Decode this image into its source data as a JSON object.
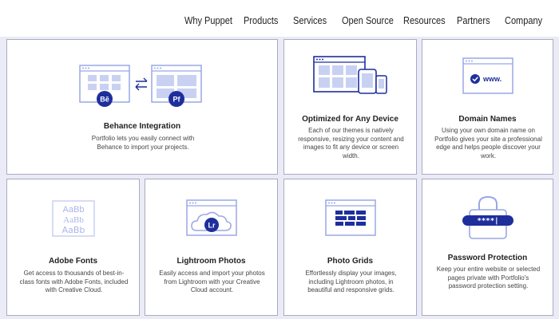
{
  "nav": {
    "items": [
      "Why Puppet",
      "Products",
      "Services",
      "Open Source",
      "Resources",
      "Partners",
      "Company"
    ]
  },
  "colors": {
    "brand_blue": "#1e2f9c",
    "icon_outline": "#9aa7e6",
    "icon_fill": "#c9d1f3",
    "page_bg": "#eaebf6",
    "card_border": "#a9abc2"
  },
  "cards": {
    "behance": {
      "title": "Behance Integration",
      "desc": "Portfolio lets you easily connect with Behance to import your projects.",
      "badge_left": "Bē",
      "badge_right": "Pf",
      "icon": "behance-sync-icon"
    },
    "device": {
      "title": "Optimized for Any Device",
      "desc": "Each of our themes is natively responsive, resizing your content and images to fit any device or screen width.",
      "icon": "devices-icon"
    },
    "domain": {
      "title": "Domain Names",
      "desc": "Using your own domain name on Portfolio gives your site a professional edge and helps people discover your work.",
      "badge": "www.",
      "icon": "domain-icon"
    },
    "fonts": {
      "title": "Adobe Fonts",
      "desc": "Get access to thousands of best-in-class fonts with Adobe Fonts, included with Creative Cloud.",
      "sample": "AaBb",
      "icon": "fonts-icon"
    },
    "lightroom": {
      "title": "Lightroom Photos",
      "desc": "Easily access and import your photos from Lightroom with your Creative Cloud account.",
      "badge": "Lr",
      "icon": "lightroom-cloud-icon"
    },
    "grids": {
      "title": "Photo Grids",
      "desc": "Effortlessly display your images, including Lightroom photos, in beautiful and responsive grids.",
      "icon": "photo-grid-icon"
    },
    "password": {
      "title": "Password Protection",
      "desc": "Keep your entire website or selected pages private with Portfolio's password protection setting.",
      "badge": "****|",
      "icon": "lock-icon"
    }
  }
}
